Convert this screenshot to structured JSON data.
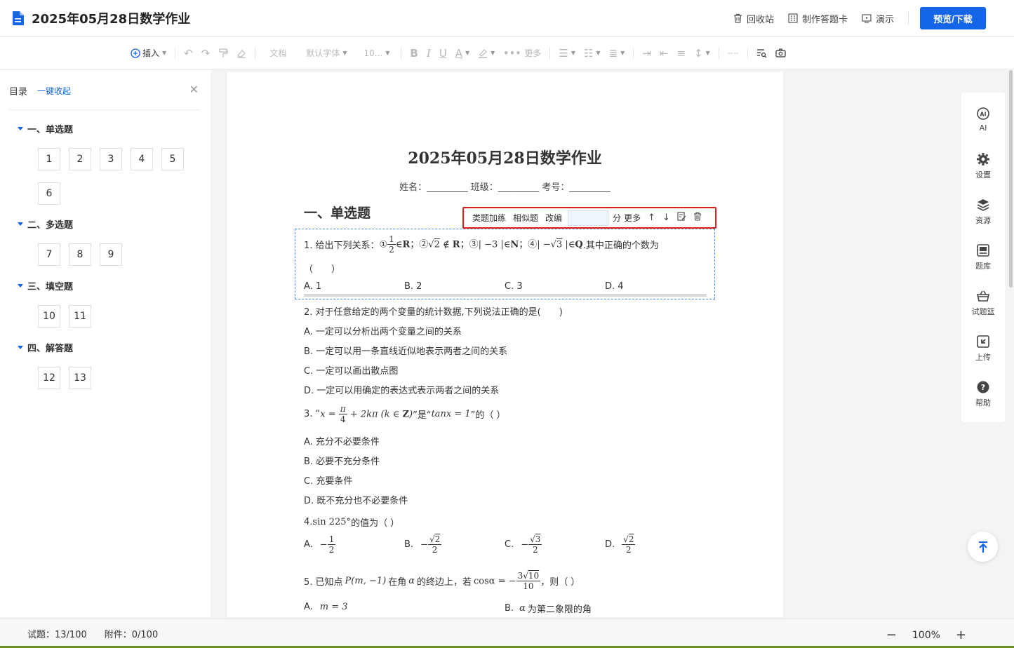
{
  "app": {
    "doc_title": "2025年05月28日数学作业",
    "recycle_label": "回收站",
    "answer_card_label": "制作答题卡",
    "present_label": "演示",
    "preview_label": "预览/下载"
  },
  "toolbar": {
    "insert_label": "插入",
    "style_label": "文档",
    "font_label": "默认字体",
    "size_label": "10...",
    "more_label": "更多"
  },
  "sidebar": {
    "title": "目录",
    "collapse_label": "一键收起",
    "sections": [
      {
        "title": "一、单选题",
        "items": [
          "1",
          "2",
          "3",
          "4",
          "5",
          "6"
        ]
      },
      {
        "title": "二、多选题",
        "items": [
          "7",
          "8",
          "9"
        ]
      },
      {
        "title": "三、填空题",
        "items": [
          "10",
          "11"
        ]
      },
      {
        "title": "四、解答题",
        "items": [
          "12",
          "13"
        ]
      }
    ]
  },
  "document": {
    "heading": "2025年05月28日数学作业",
    "info_line": "姓名：_________ 班级：_________ 考号：_________",
    "section_title": "一、单选题",
    "question_toolbar": {
      "similar_practice": "类题加练",
      "similar": "相似题",
      "adapt": "改编",
      "score_unit": "分",
      "more": "更多"
    },
    "q1": {
      "stem_prefix": "1. 给出下列关系：",
      "stem_suffix": ".其中正确的个数为",
      "blank": "（　　）",
      "options": [
        "A. 1",
        "B. 2",
        "C. 3",
        "D. 4"
      ]
    },
    "q2": {
      "stem": "2. 对于任意给定的两个变量的统计数据,下列说法正确的是(　　)",
      "options": [
        "A. 一定可以分析出两个变量之间的关系",
        "B. 一定可以用一条直线近似地表示两者之间的关系",
        "C. 一定可以画出散点图",
        "D. 一定可以用确定的表达式表示两者之间的关系"
      ]
    },
    "q3": {
      "prefix": "3. “",
      "middle": "”是“",
      "suffix": "”的（ ）",
      "options": [
        "A. 充分不必要条件",
        "B. 必要不充分条件",
        "C. 充要条件",
        "D. 既不充分也不必要条件"
      ]
    },
    "q4": {
      "prefix": "4. ",
      "suffix": " 的值为（ ）",
      "option_labels": [
        "A.",
        "B.",
        "C.",
        "D."
      ]
    },
    "q5": {
      "prefix": "5. 已知点",
      "mid1": "在角",
      "mid2": "的终边上，若",
      "suffix": "，则（ ）",
      "option_a": "A.",
      "option_b_label": "B.",
      "option_b_text": "为第二象限的角"
    }
  },
  "rightbar": {
    "items": [
      "AI",
      "设置",
      "资源",
      "题库",
      "试题篮",
      "上传",
      "帮助"
    ]
  },
  "status": {
    "questions": "试题：13/100",
    "attachments": "附件：0/100",
    "zoom": "100%"
  },
  "colors": {
    "primary": "#1565e8",
    "highlight_border": "#e02020"
  }
}
